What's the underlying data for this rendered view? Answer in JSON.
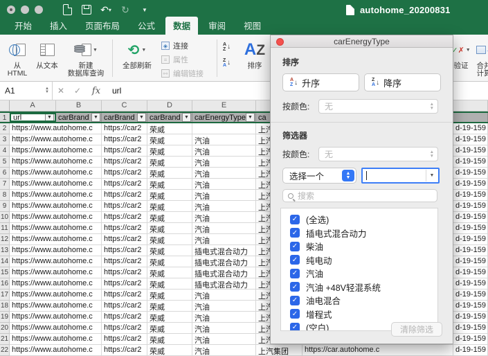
{
  "window": {
    "title": "autohome_20200831"
  },
  "tabs": [
    {
      "key": "home",
      "label": "开始",
      "active": false
    },
    {
      "key": "insert",
      "label": "插入",
      "active": false
    },
    {
      "key": "page-layout",
      "label": "页面布局",
      "active": false
    },
    {
      "key": "formulas",
      "label": "公式",
      "active": false
    },
    {
      "key": "data",
      "label": "数据",
      "active": true
    },
    {
      "key": "review",
      "label": "审阅",
      "active": false
    },
    {
      "key": "view",
      "label": "视图",
      "active": false
    }
  ],
  "ribbon": {
    "from_html": "从\nHTML",
    "from_text": "从文本",
    "new_db_query": "新建\n数据库查询",
    "refresh_all": "全部刷新",
    "connections": "连接",
    "properties": "属性",
    "edit_links": "编辑链接",
    "sort": "排序",
    "validate": "验证",
    "consolidate": "合并\n计算"
  },
  "formula_bar": {
    "name_box": "A1",
    "fx_label": "fx",
    "value": "url"
  },
  "grid": {
    "col_letters": [
      "A",
      "B",
      "C",
      "D",
      "E",
      "",
      "",
      ""
    ],
    "header_row": {
      "a": "url",
      "b": "carBrand",
      "c": "carBrand",
      "d": "carBrand",
      "e": "carEnergyType",
      "f": "ca",
      "g": "",
      "h": ""
    },
    "common_cells": {
      "url": "https://www.autohome.c",
      "brand_link": "https://car2",
      "brand": "荣威",
      "group": "上汽集团",
      "group_link": "https://car.autohome.c",
      "tail": "d-19-159"
    },
    "rows": [
      {
        "n": 2,
        "energy": ""
      },
      {
        "n": 3,
        "energy": "汽油"
      },
      {
        "n": 4,
        "energy": "汽油"
      },
      {
        "n": 5,
        "energy": "汽油"
      },
      {
        "n": 6,
        "energy": "汽油"
      },
      {
        "n": 7,
        "energy": "汽油"
      },
      {
        "n": 8,
        "energy": "汽油"
      },
      {
        "n": 9,
        "energy": "汽油"
      },
      {
        "n": 10,
        "energy": "汽油"
      },
      {
        "n": 11,
        "energy": "汽油"
      },
      {
        "n": 12,
        "energy": "汽油"
      },
      {
        "n": 13,
        "energy": "插电式混合动力"
      },
      {
        "n": 14,
        "energy": "插电式混合动力"
      },
      {
        "n": 15,
        "energy": "插电式混合动力"
      },
      {
        "n": 16,
        "energy": "插电式混合动力"
      },
      {
        "n": 17,
        "energy": "汽油"
      },
      {
        "n": 18,
        "energy": "汽油"
      },
      {
        "n": 19,
        "energy": "汽油"
      },
      {
        "n": 20,
        "energy": "汽油"
      },
      {
        "n": 21,
        "energy": "汽油"
      },
      {
        "n": 22,
        "energy": "汽油"
      }
    ]
  },
  "dialog": {
    "title": "carEnergyType",
    "sort": {
      "heading": "排序",
      "ascending": "升序",
      "descending": "降序",
      "by_color_label": "按颜色:",
      "by_color_value": "无"
    },
    "filter": {
      "heading": "筛选器",
      "by_color_label": "按颜色:",
      "by_color_value": "无",
      "chooser_label": "选择一个",
      "combo_value": "",
      "search_placeholder": "搜索",
      "items": [
        {
          "label": "(全选)",
          "checked": true
        },
        {
          "label": "插电式混合动力",
          "checked": true
        },
        {
          "label": "柴油",
          "checked": true
        },
        {
          "label": "纯电动",
          "checked": true
        },
        {
          "label": "汽油",
          "checked": true
        },
        {
          "label": "汽油 +48V轻混系统",
          "checked": true
        },
        {
          "label": "油电混合",
          "checked": true
        },
        {
          "label": "增程式",
          "checked": true
        },
        {
          "label": "(空白)",
          "checked": true
        }
      ]
    },
    "clear_button": "清除筛选"
  },
  "colors": {
    "excel_green": "#1e7145",
    "checkbox_blue": "#2c67e8",
    "focus_blue": "#3d7ef7",
    "refresh_green": "#21a366"
  }
}
